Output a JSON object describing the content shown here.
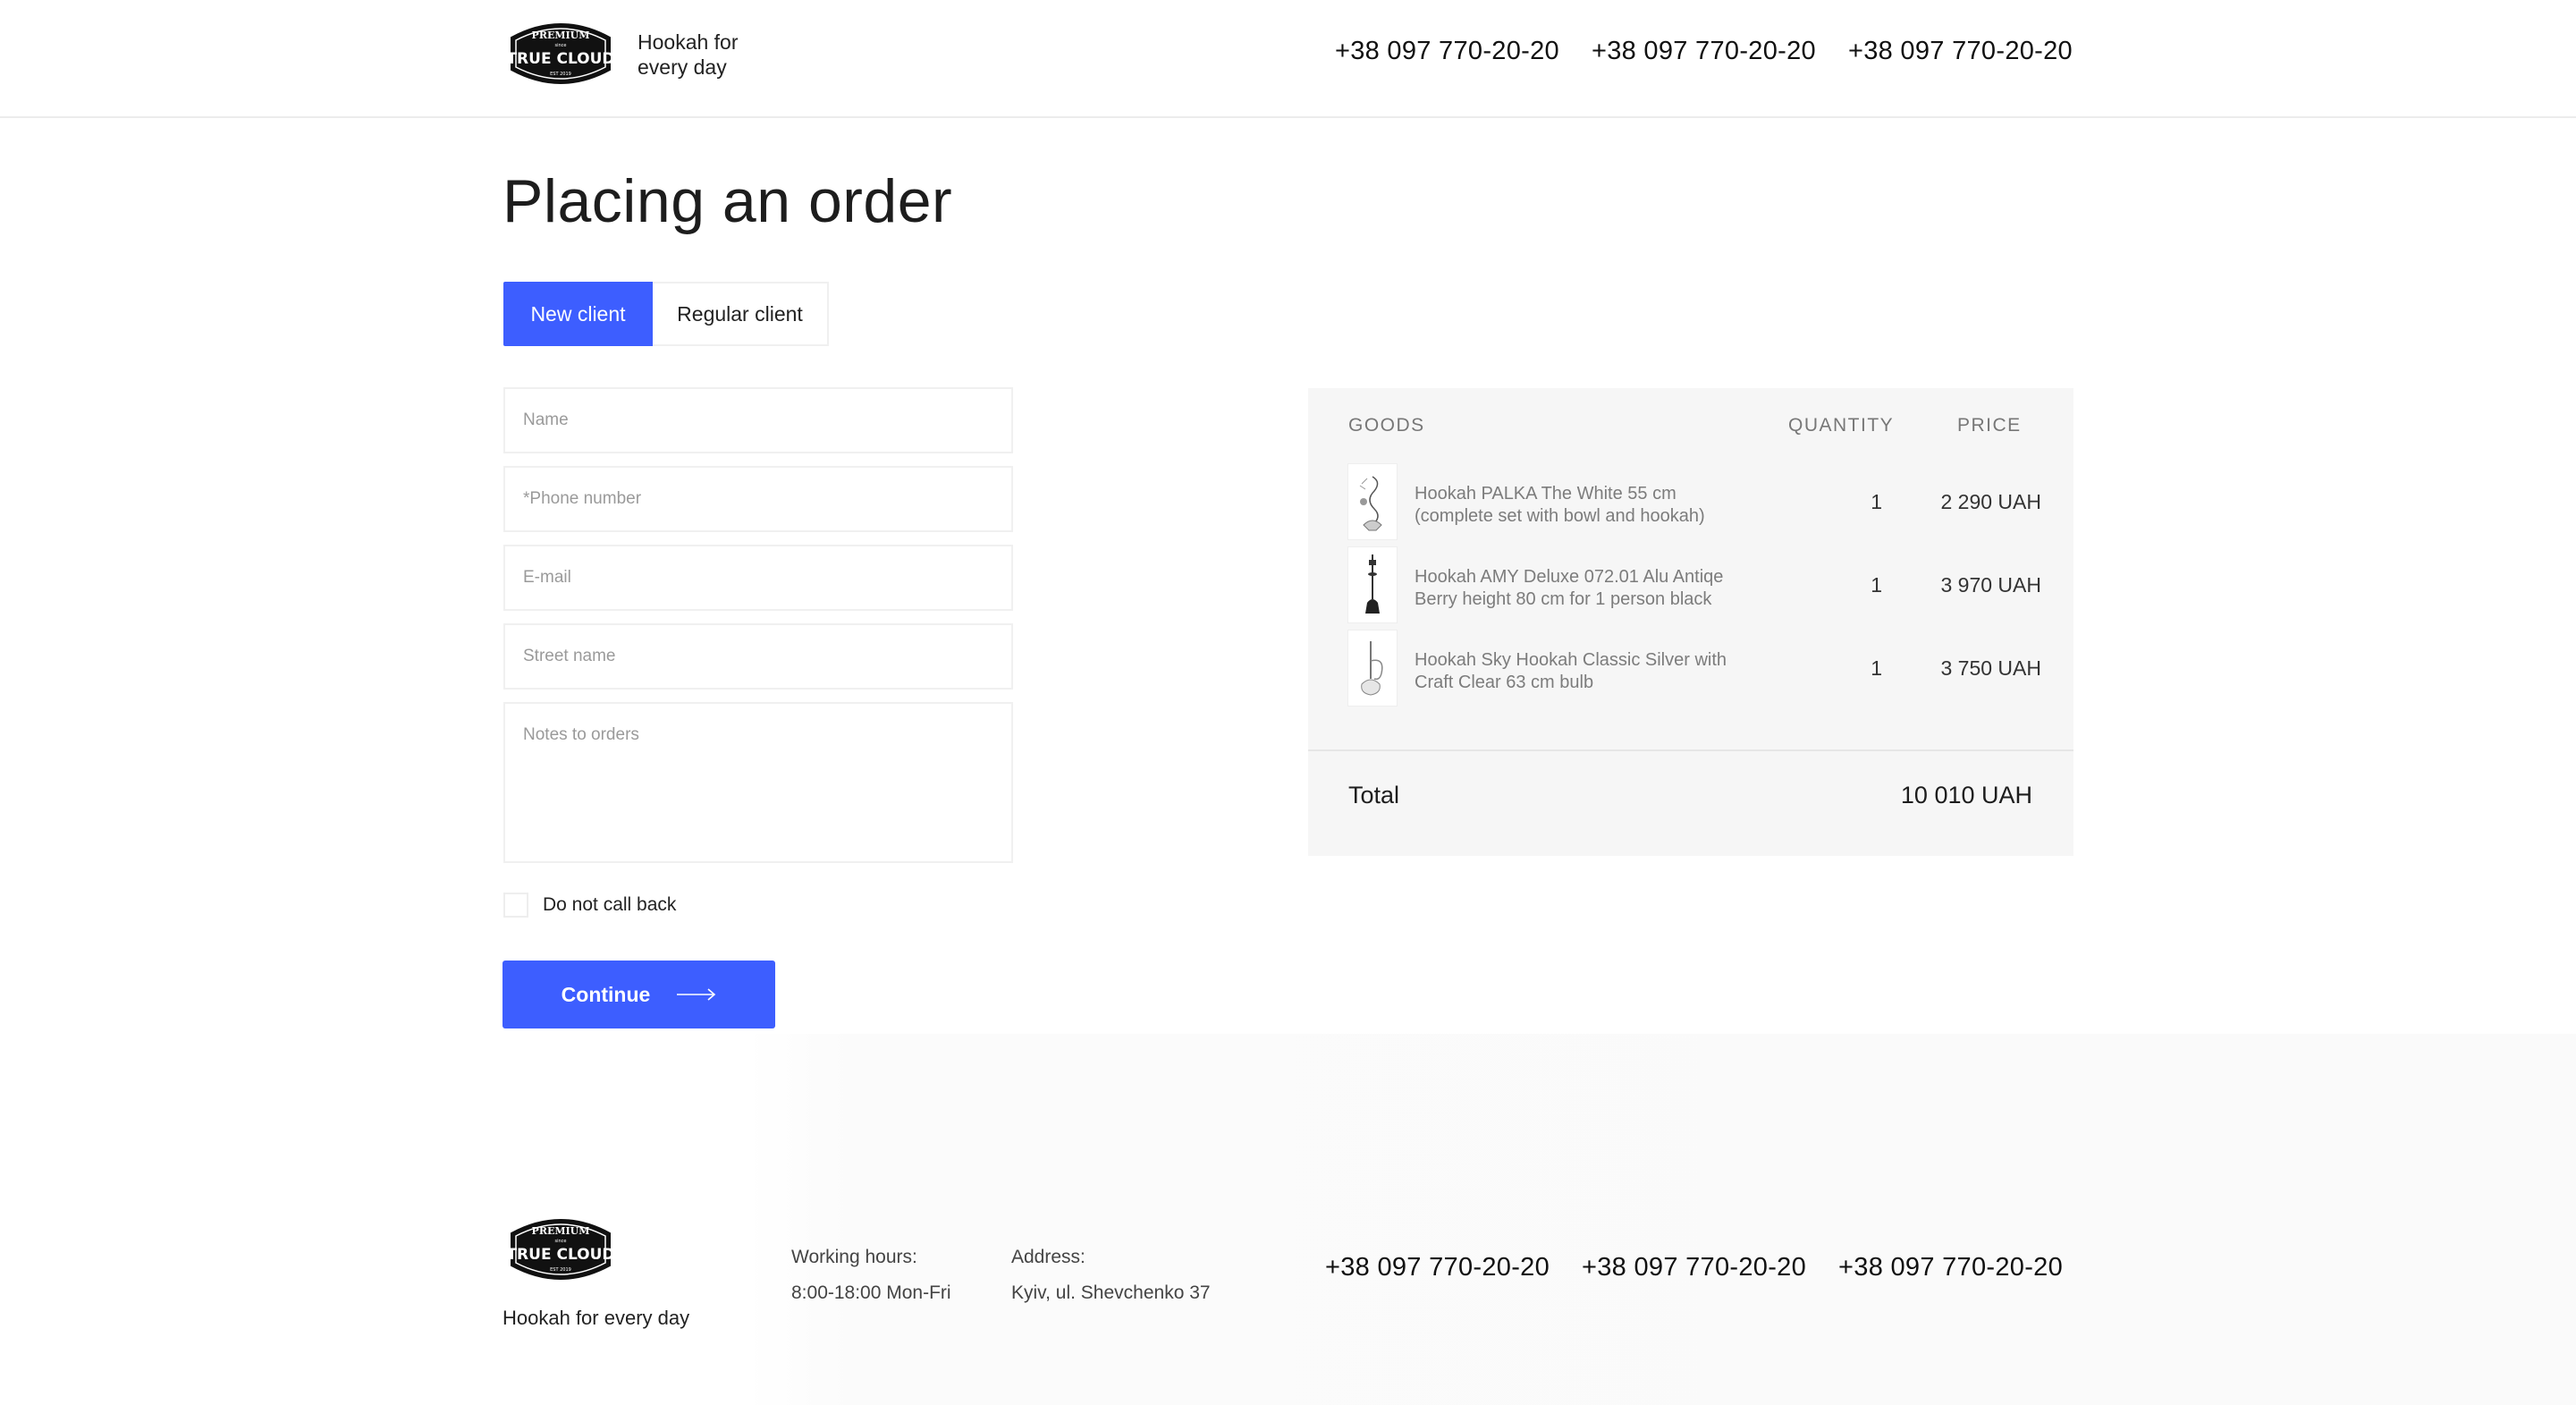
{
  "brand": {
    "logo_top": "PREMIUM",
    "logo_main": "TRUE CLOUD",
    "tagline_header": "Hookah for every day",
    "tagline_footer": "Hookah for every day"
  },
  "header": {
    "phones": [
      "+38 097 770-20-20",
      "+38 097 770-20-20",
      "+38 097 770-20-20"
    ]
  },
  "page": {
    "title": "Placing an order"
  },
  "tabs": [
    {
      "label": "New client",
      "active": true
    },
    {
      "label": "Regular client",
      "active": false
    }
  ],
  "form": {
    "name_placeholder": "Name",
    "phone_placeholder": "*Phone number",
    "email_placeholder": "E-mail",
    "street_placeholder": "Street name",
    "notes_placeholder": "Notes to orders",
    "no_callback_label": "Do not call back",
    "no_callback_checked": false,
    "continue_label": "Continue"
  },
  "summary": {
    "headers": {
      "goods": "GOODS",
      "quantity": "QUANTITY",
      "price": "PRICE"
    },
    "items": [
      {
        "name": "Hookah PALKA The White 55 cm (complete set with bowl and hookah)",
        "quantity": "1",
        "price": "2 290 UAH",
        "icon": "hookah-white-icon"
      },
      {
        "name": "Hookah AMY Deluxe 072.01 Alu Antiqe Berry height 80 cm for 1 person black",
        "quantity": "1",
        "price": "3 970 UAH",
        "icon": "hookah-black-icon"
      },
      {
        "name": "Hookah Sky Hookah Classic Silver with Craft Clear 63 cm bulb",
        "quantity": "1",
        "price": "3 750 UAH",
        "icon": "hookah-silver-icon"
      }
    ],
    "total_label": "Total",
    "total_value": "10 010 UAH"
  },
  "footer": {
    "hours_label": "Working hours:",
    "hours_value": "8:00-18:00 Mon-Fri",
    "address_label": "Address:",
    "address_value": "Kyiv, ul. Shevchenko 37",
    "phones": [
      "+38 097 770-20-20",
      "+38 097 770-20-20",
      "+38 097 770-20-20"
    ]
  },
  "colors": {
    "accent": "#3d5eff",
    "summary_bg": "#f6f6f6",
    "border": "#f0f0f0"
  }
}
